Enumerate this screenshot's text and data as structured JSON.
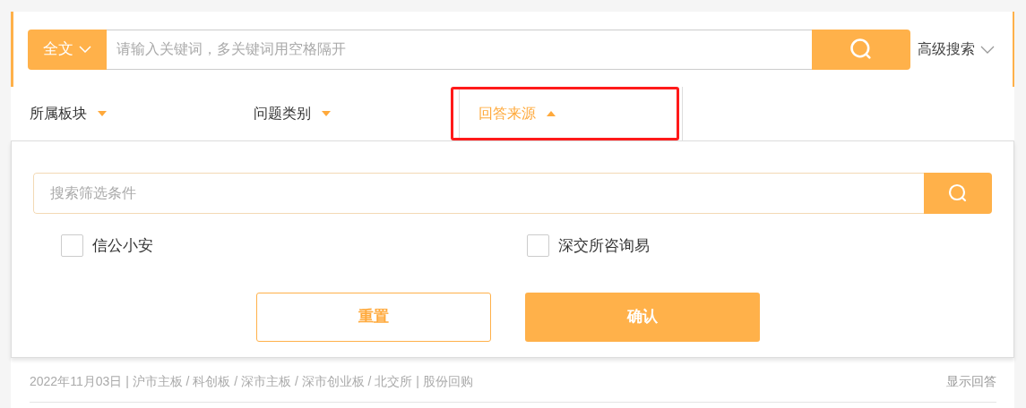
{
  "search": {
    "scope": "全文",
    "placeholder": "请输入关键词，多关键词用空格隔开",
    "advanced": "高级搜索"
  },
  "filters": [
    {
      "label": "所属板块",
      "selected": false,
      "annotated": false
    },
    {
      "label": "问题类别",
      "selected": false,
      "annotated": false
    },
    {
      "label": "回答来源",
      "selected": true,
      "annotated": true
    }
  ],
  "dropdown": {
    "placeholder": "搜索筛选条件",
    "options": [
      {
        "label": "信公小安",
        "checked": false
      },
      {
        "label": "深交所咨询易",
        "checked": false
      }
    ],
    "reset": "重置",
    "confirm": "确认"
  },
  "result": {
    "meta": "2022年11月03日 | 沪市主板 / 科创板 / 深市主板 / 深市创业板 / 北交所 | 股份回购",
    "toggle": "显示回答"
  }
}
